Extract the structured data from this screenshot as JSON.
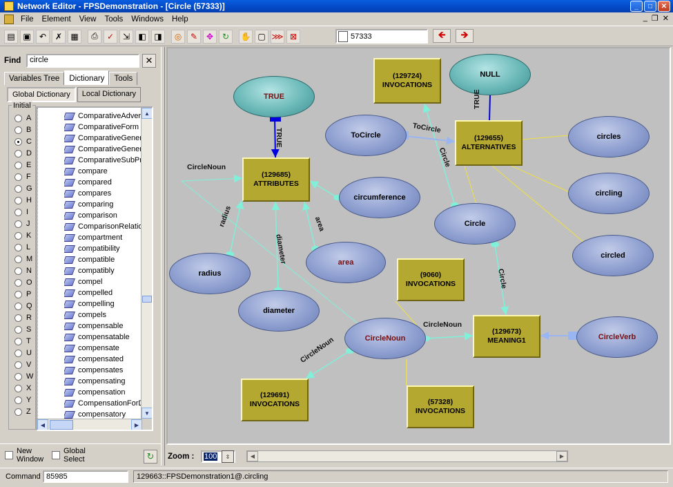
{
  "window": {
    "title": "Network Editor - FPSDemonstration - [Circle (57333)]"
  },
  "menu": {
    "items": [
      "File",
      "Element",
      "View",
      "Tools",
      "Windows",
      "Help"
    ]
  },
  "toolbar": {
    "node_id": "57333"
  },
  "left_panel": {
    "find_label": "Find",
    "find_value": "circle",
    "tabs": [
      "Variables Tree",
      "Dictionary",
      "Tools"
    ],
    "active_tab": "Dictionary",
    "subtabs": [
      "Global Dictionary",
      "Local Dictionary"
    ],
    "initial_label": "Initial",
    "letters": [
      "A",
      "B",
      "C",
      "D",
      "E",
      "F",
      "G",
      "H",
      "I",
      "J",
      "K",
      "L",
      "M",
      "N",
      "O",
      "P",
      "Q",
      "R",
      "S",
      "T",
      "U",
      "V",
      "W",
      "X",
      "Y",
      "Z"
    ],
    "selected_letter": "C",
    "words": [
      "ComparativeAdverb",
      "ComparativeForm",
      "ComparativeGenera",
      "ComparativeGenera",
      "ComparativeSubPre",
      "compare",
      "compared",
      "compares",
      "comparing",
      "comparison",
      "ComparisonRelation",
      "compartment",
      "compatibility",
      "compatible",
      "compatibly",
      "compel",
      "compelled",
      "compelling",
      "compels",
      "compensable",
      "compensatable",
      "compensate",
      "compensated",
      "compensates",
      "compensating",
      "compensation",
      "CompensationForD",
      "compensatory"
    ],
    "new_window_label": "New\nWindow",
    "global_select_label": "Global\nSelect"
  },
  "graph": {
    "nodes": [
      {
        "id": "true",
        "kind": "teal",
        "label": "TRUE",
        "dark": true
      },
      {
        "id": "null",
        "kind": "teal",
        "label": "NULL",
        "dark": false
      },
      {
        "id": "attributes",
        "kind": "box",
        "label": "(129685)\nATTRIBUTES"
      },
      {
        "id": "inv129724",
        "kind": "box",
        "label": "(129724)\nINVOCATIONS"
      },
      {
        "id": "alternatives",
        "kind": "box",
        "label": "(129655)\nALTERNATIVES"
      },
      {
        "id": "tocircle",
        "kind": "ell",
        "label": "ToCircle",
        "dark": false
      },
      {
        "id": "circles",
        "kind": "ell",
        "label": "circles",
        "dark": false
      },
      {
        "id": "circumference",
        "kind": "ell",
        "label": "circumference",
        "dark": false
      },
      {
        "id": "circling",
        "kind": "ell",
        "label": "circling",
        "dark": false
      },
      {
        "id": "circle",
        "kind": "ell",
        "label": "Circle",
        "dark": false
      },
      {
        "id": "circled",
        "kind": "ell",
        "label": "circled",
        "dark": false
      },
      {
        "id": "radius",
        "kind": "ell",
        "label": "radius",
        "dark": false
      },
      {
        "id": "area",
        "kind": "ell",
        "label": "area",
        "dark": true
      },
      {
        "id": "inv9060",
        "kind": "box",
        "label": "(9060)\nINVOCATIONS"
      },
      {
        "id": "diameter",
        "kind": "ell",
        "label": "diameter",
        "dark": false
      },
      {
        "id": "meaning1",
        "kind": "box",
        "label": "(129673)\nMEANING1"
      },
      {
        "id": "circlenoun",
        "kind": "ell",
        "label": "CircleNoun",
        "dark": true
      },
      {
        "id": "circleverb",
        "kind": "ell",
        "label": "CircleVerb",
        "dark": true
      },
      {
        "id": "inv129691",
        "kind": "box",
        "label": "(129691)\nINVOCATIONS"
      },
      {
        "id": "inv57328",
        "kind": "box",
        "label": "(57328)\nINVOCATIONS"
      }
    ],
    "edge_labels": [
      {
        "id": "lbl-true-attr",
        "text": "TRUE"
      },
      {
        "id": "lbl-true-null",
        "text": "TRUE"
      },
      {
        "id": "lbl-circlenoun-top",
        "text": "CircleNoun"
      },
      {
        "id": "lbl-radius",
        "text": "radius"
      },
      {
        "id": "lbl-diameter",
        "text": "diameter"
      },
      {
        "id": "lbl-area",
        "text": "area"
      },
      {
        "id": "lbl-tocircle",
        "text": "ToCircle"
      },
      {
        "id": "lbl-circle-alt",
        "text": "Circle"
      },
      {
        "id": "lbl-circle-meaning",
        "text": "Circle"
      },
      {
        "id": "lbl-circlenoun-meaning",
        "text": "CircleNoun"
      },
      {
        "id": "lbl-circlenoun-inv",
        "text": "CircleNoun"
      }
    ]
  },
  "zoom": {
    "label": "Zoom :",
    "value": "100"
  },
  "status": {
    "command_label": "Command",
    "command_value": "85985",
    "path": "129663::FPSDemonstration1@.circling"
  },
  "colors": {
    "canvas": "#c0c0c0",
    "box": "#b5a830",
    "ellipse": "#8e9fd0",
    "teal": "#6ab8b8",
    "arrow_teal": "#80f0d8",
    "arrow_blue": "#0000e0",
    "line_yellow": "#f0e040"
  }
}
